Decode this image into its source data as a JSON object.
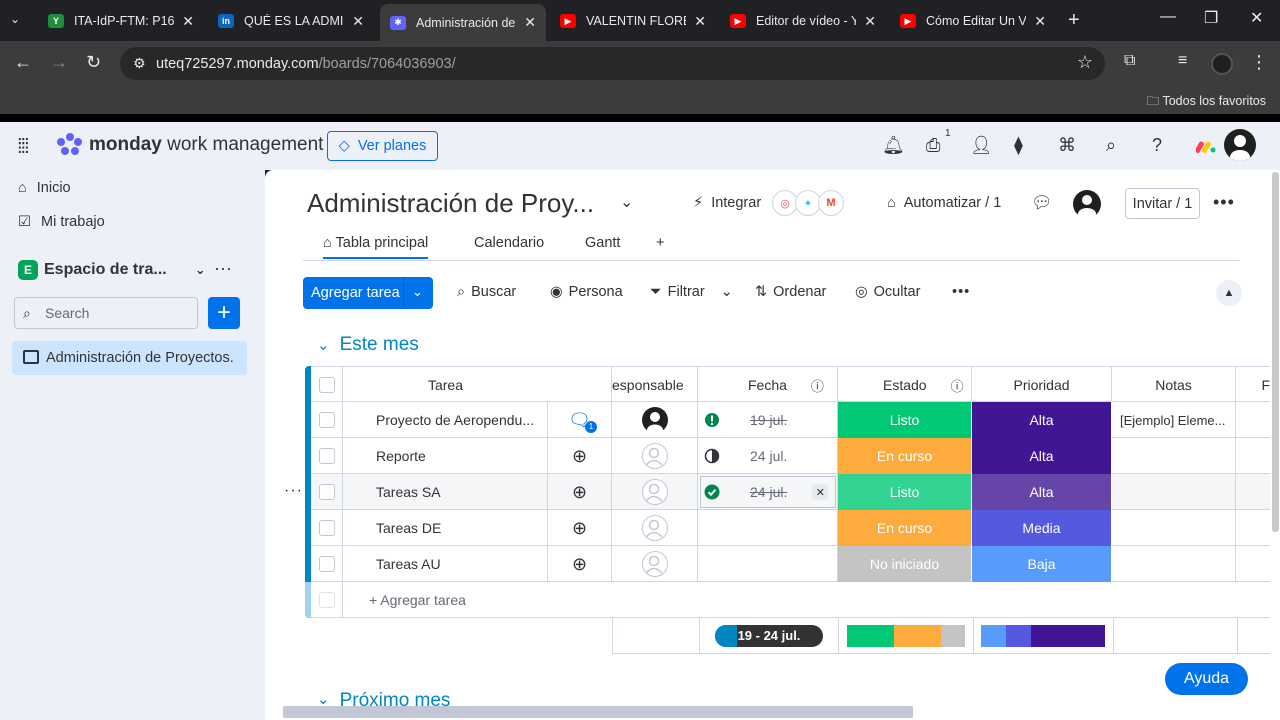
{
  "browser": {
    "tabs": [
      {
        "title": "ITA-IdP-FTM: P16.",
        "fav_color": "#1e8e3e",
        "fav_text": "Y"
      },
      {
        "title": "QUÉ ES LA ADMIN",
        "fav_color": "#0a66c2",
        "fav_text": "in"
      },
      {
        "title": "Administración de",
        "fav_color": "#6161ff",
        "fav_text": "✱"
      },
      {
        "title": "VALENTIN FLORES",
        "fav_color": "#ff0000",
        "fav_text": "▶"
      },
      {
        "title": "Editor de vídeo - Y",
        "fav_color": "#ff0000",
        "fav_text": "▶"
      },
      {
        "title": "Cómo Editar Un Vi",
        "fav_color": "#ff0000",
        "fav_text": "▶"
      }
    ],
    "url_host": "uteq725297.monday.com",
    "url_path": "/boards/7064036903/",
    "bookmarks_all": "Todos los favoritos"
  },
  "header": {
    "brand_bold": "monday",
    "brand_rest": " work management",
    "ver_planes": "Ver planes",
    "inbox_badge": "1"
  },
  "sidebar": {
    "inicio": "Inicio",
    "mi_trabajo": "Mi trabajo",
    "workspace_letter": "E",
    "workspace": "Espacio de tra...",
    "search_placeholder": "Search",
    "board": "Administración de Proyectos."
  },
  "board": {
    "title": "Administración de Proy...",
    "integrar": "Integrar",
    "automatizar": "Automatizar / 1",
    "invitar": "Invitar / 1",
    "views": [
      "Tabla principal",
      "Calendario",
      "Gantt",
      "+"
    ],
    "toolbar": {
      "agregar": "Agregar tarea",
      "buscar": "Buscar",
      "persona": "Persona",
      "filtrar": "Filtrar",
      "ordenar": "Ordenar",
      "ocultar": "Ocultar"
    },
    "group_title": "Este mes",
    "next_group": "Próximo mes",
    "columns": {
      "tarea": "Tarea",
      "responsable": "esponsable",
      "fecha": "Fecha",
      "estado": "Estado",
      "prioridad": "Prioridad",
      "notas": "Notas",
      "extra": "F"
    },
    "rows": [
      {
        "name": "Proyecto de Aeropendu...",
        "update_badge": "1",
        "date": "19 jul.",
        "date_strike": true,
        "date_icon": "alert-icon",
        "estado": "Listo",
        "estado_color": "#00c875",
        "prioridad": "Alta",
        "prioridad_color": "#401694",
        "notas": "[Ejemplo] Eleme..."
      },
      {
        "name": "Reporte",
        "update_badge": "",
        "date": "24 jul.",
        "date_strike": false,
        "date_icon": "half-circle-icon",
        "estado": "En curso",
        "estado_color": "#fdab3d",
        "prioridad": "Alta",
        "prioridad_color": "#401694",
        "notas": ""
      },
      {
        "name": "Tareas SA",
        "update_badge": "",
        "date": "24 jul.",
        "date_strike": true,
        "date_icon": "check-circle-icon",
        "estado": "Listo",
        "estado_color": "#33d391",
        "prioridad": "Alta",
        "prioridad_color": "#6645a9",
        "notas": ""
      },
      {
        "name": "Tareas DE",
        "update_badge": "",
        "date": "",
        "date_strike": false,
        "date_icon": "",
        "estado": "En curso",
        "estado_color": "#fdab3d",
        "prioridad": "Media",
        "prioridad_color": "#5559df",
        "notas": ""
      },
      {
        "name": "Tareas AU",
        "update_badge": "",
        "date": "",
        "date_strike": false,
        "date_icon": "",
        "estado": "No iniciado",
        "estado_color": "#c4c4c4",
        "prioridad": "Baja",
        "prioridad_color": "#579bfc",
        "notas": ""
      }
    ],
    "add_row": "+ Agregar tarea",
    "summary_date": "19 - 24 jul.",
    "estado_summary_colors": [
      "#00c875",
      "#00c875",
      "#fdab3d",
      "#fdab3d",
      "#c4c4c4"
    ],
    "prioridad_summary_colors": [
      "#579bfc",
      "#5559df",
      "#401694",
      "#401694",
      "#401694"
    ],
    "ayuda": "Ayuda"
  }
}
